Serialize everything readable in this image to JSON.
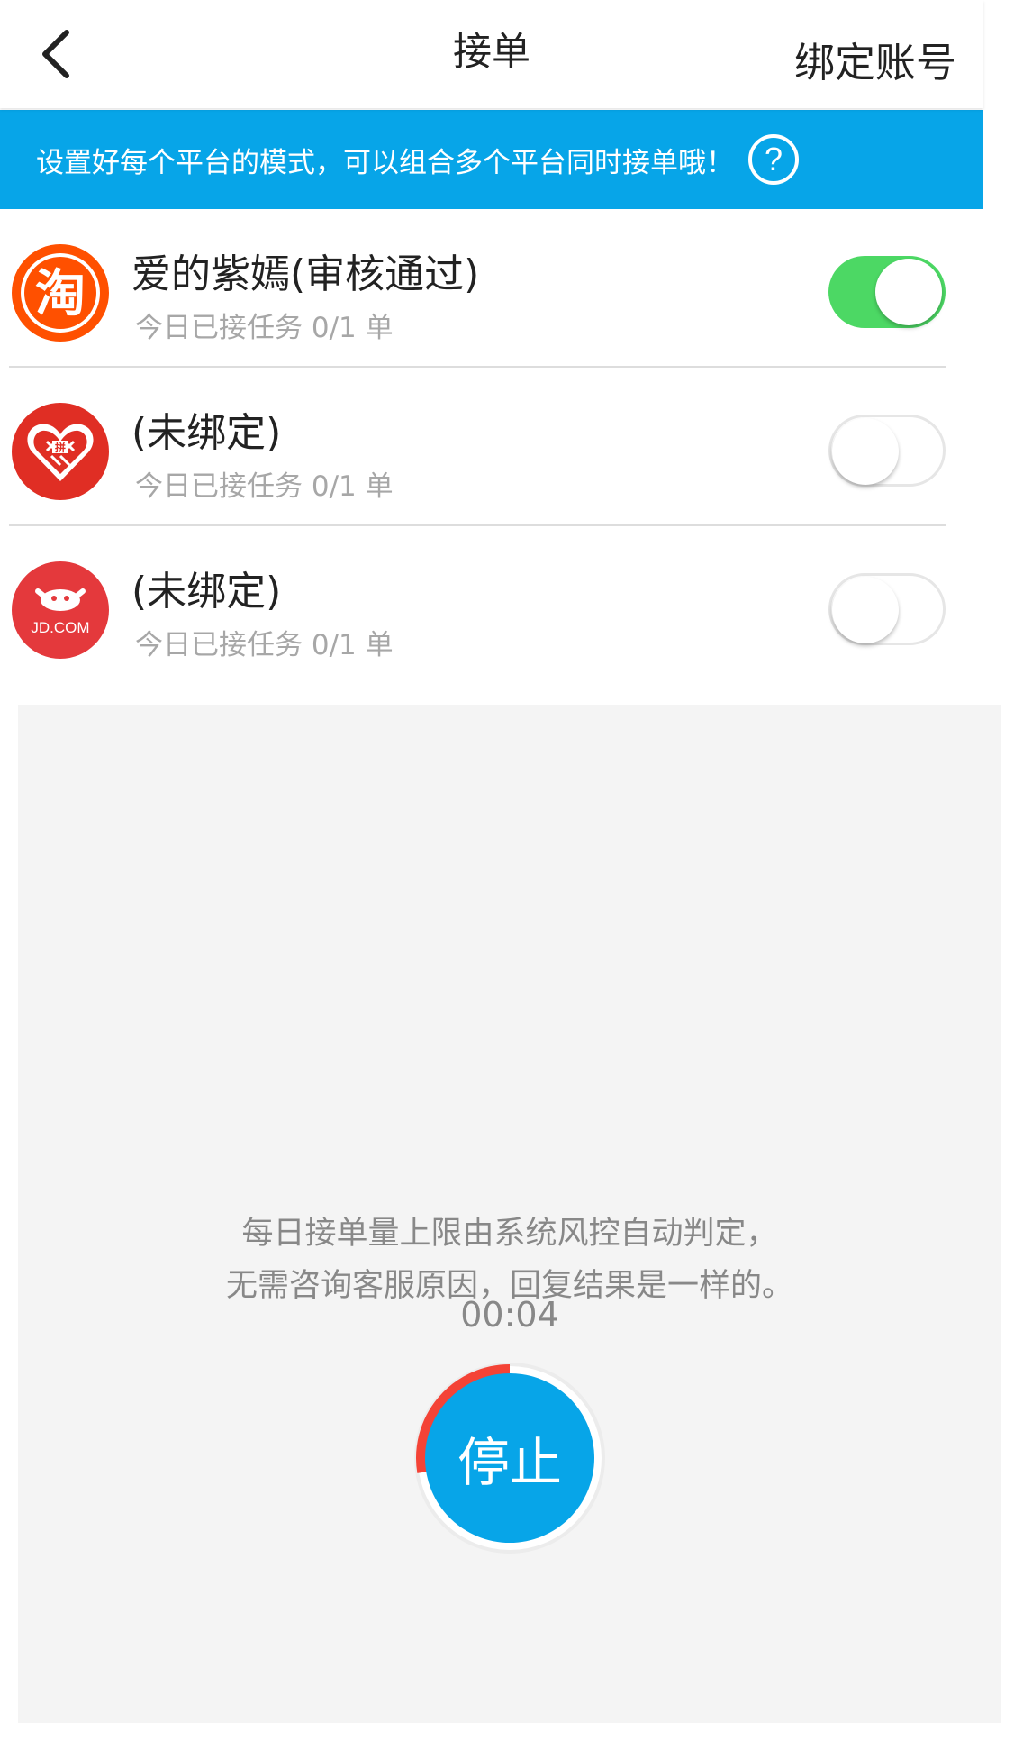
{
  "header": {
    "title": "接单",
    "bind_account": "绑定账号"
  },
  "banner": {
    "text": "设置好每个平台的模式，可以组合多个平台同时接单哦！"
  },
  "platforms": [
    {
      "name": "爱的紫嫣(审核通过)",
      "subtitle": "今日已接任务 0/1 单",
      "enabled": true,
      "logo": "taobao-logo",
      "logo_text": "淘"
    },
    {
      "name": "(未绑定)",
      "subtitle": "今日已接任务 0/1 单",
      "enabled": false,
      "logo": "pinduoduo-logo",
      "logo_text": "拼"
    },
    {
      "name": "(未绑定)",
      "subtitle": "今日已接任务 0/1 单",
      "enabled": false,
      "logo": "jd-logo",
      "logo_text": "JD.COM"
    }
  ],
  "panel": {
    "notice_line1": "每日接单量上限由系统风控自动判定，",
    "notice_line2": "无需咨询客服原因，回复结果是一样的。",
    "timer": "00:04",
    "stop_label": "停止",
    "progress_fraction": 0.12
  },
  "colors": {
    "accent": "#07a5e8",
    "switch_on": "#4cd864",
    "progress": "#f44336"
  }
}
